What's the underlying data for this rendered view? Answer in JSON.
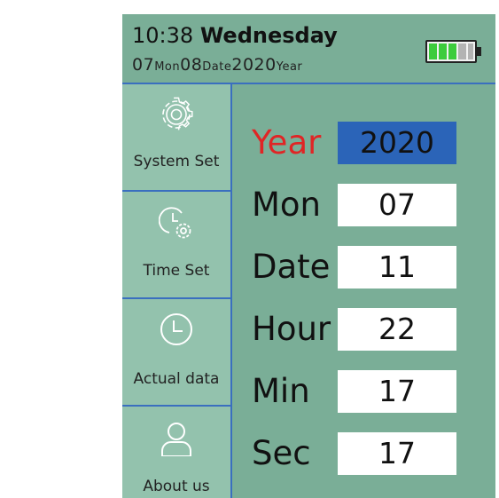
{
  "header": {
    "time": "10:38",
    "weekday": "Wednesday",
    "date_parts": [
      "07",
      "Mon",
      "08",
      "Date",
      "2020",
      "Year"
    ],
    "battery": {
      "level_fraction": 0.6,
      "fill_color": "#3ccc3c",
      "empty_color": "#b3b3b3"
    }
  },
  "sidebar": {
    "items": [
      {
        "label": "System Set",
        "icon": "gear-icon",
        "active": false
      },
      {
        "label": "Time Set",
        "icon": "clock-gear-icon",
        "active": true
      },
      {
        "label": "Actual data",
        "icon": "clock-icon",
        "active": false
      },
      {
        "label": "About us",
        "icon": "user-icon",
        "active": false
      }
    ]
  },
  "form": {
    "fields": [
      {
        "label": "Year",
        "value": "2020",
        "selected": true
      },
      {
        "label": "Mon",
        "value": "07",
        "selected": false
      },
      {
        "label": "Date",
        "value": "11",
        "selected": false
      },
      {
        "label": "Hour",
        "value": "22",
        "selected": false
      },
      {
        "label": "Min",
        "value": "17",
        "selected": false
      },
      {
        "label": "Sec",
        "value": "17",
        "selected": false
      }
    ]
  },
  "colors": {
    "panel": "#7aae97",
    "sidebar_item": "#93c2ad",
    "sidebar_active": "#5a8c76",
    "divider": "#3a6fbf",
    "selected_input": "#2b64b8",
    "highlight_label": "#e02525"
  }
}
